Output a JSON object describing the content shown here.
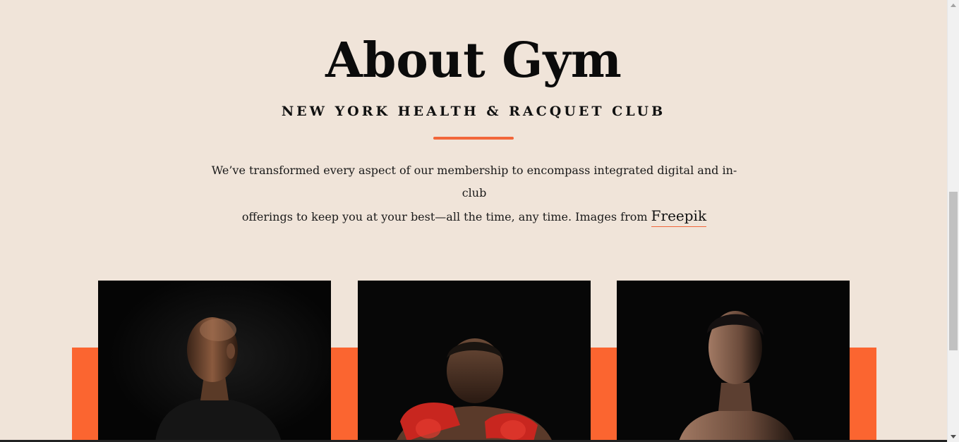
{
  "about": {
    "title": "About Gym",
    "subtitle": "NEW YORK HEALTH & RACQUET CLUB",
    "description_line1": "We’ve transformed every aspect of our membership to encompass integrated digital and in-club",
    "description_line2": "offerings to keep you at your best—all the time, any time. Images from",
    "credit_link": "Freepik"
  },
  "gallery": {
    "items": [
      {
        "alt": "athlete looking sideways in dark shirt",
        "icon": "photo-icon"
      },
      {
        "alt": "boxer with red hand wraps in guard",
        "icon": "photo-icon"
      },
      {
        "alt": "shirtless fighter in shadow",
        "icon": "photo-icon"
      }
    ]
  },
  "colors": {
    "accent": "#fb6530",
    "background": "#f0e4d9",
    "text": "#111111"
  }
}
